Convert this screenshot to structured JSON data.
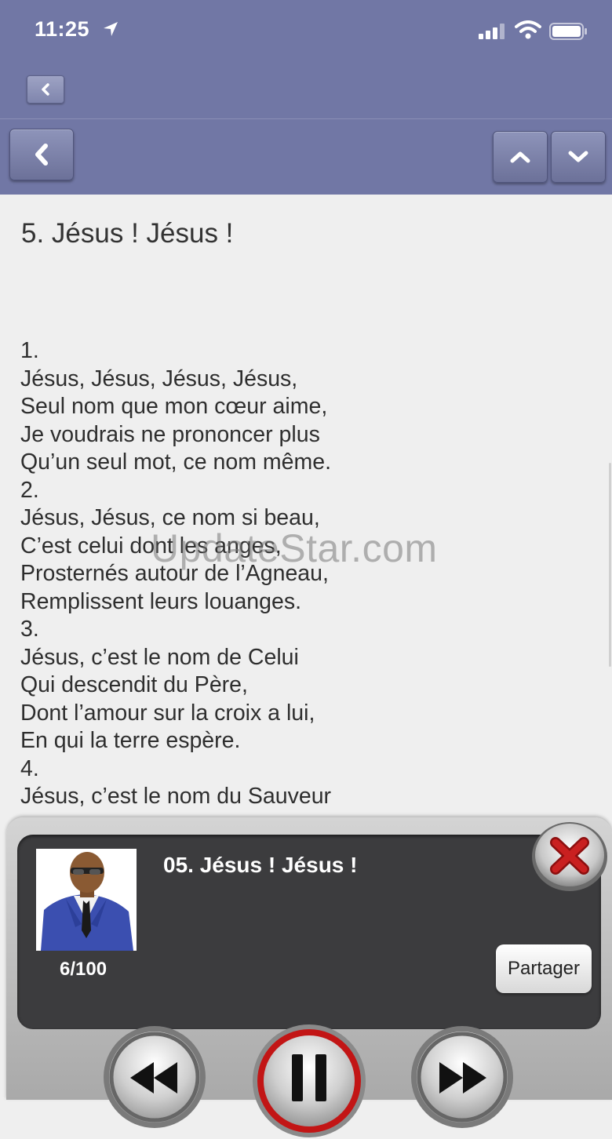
{
  "status_bar": {
    "time": "11:25"
  },
  "song": {
    "title": "5. Jésus ! Jésus !",
    "lines": [
      "1.",
      "Jésus, Jésus, Jésus, Jésus,",
      "Seul nom que mon cœur aime,",
      "Je voudrais ne prononcer plus",
      "Qu’un seul mot, ce nom même.",
      "2.",
      "Jésus, Jésus, ce nom si beau,",
      "C’est celui dont les anges,",
      "Prosternés autour de l’Agneau,",
      "Remplissent leurs louanges.",
      "3.",
      "Jésus, c’est le nom de Celui",
      "Qui descendit du Père,",
      "Dont l’amour sur la croix a lui,",
      "En qui la terre espère.",
      "4.",
      "Jésus, c’est le nom du Sauveur"
    ]
  },
  "watermark": "UpdateStar.com",
  "player": {
    "track_title": "05. Jésus ! Jésus !",
    "counter": "6/100",
    "share_label": "Partager"
  },
  "colors": {
    "nav_bar": "#7177a5",
    "content_bg": "#efefef",
    "player_panel": "#3c3c3e",
    "close_red": "#b51e1e",
    "pause_ring": "#cc1a1a"
  },
  "icons": [
    "location-arrow-icon",
    "signal-icon",
    "wifi-icon",
    "battery-icon",
    "chevron-left-icon",
    "chevron-up-icon",
    "chevron-down-icon",
    "close-icon",
    "rewind-icon",
    "pause-icon",
    "fast-forward-icon"
  ]
}
